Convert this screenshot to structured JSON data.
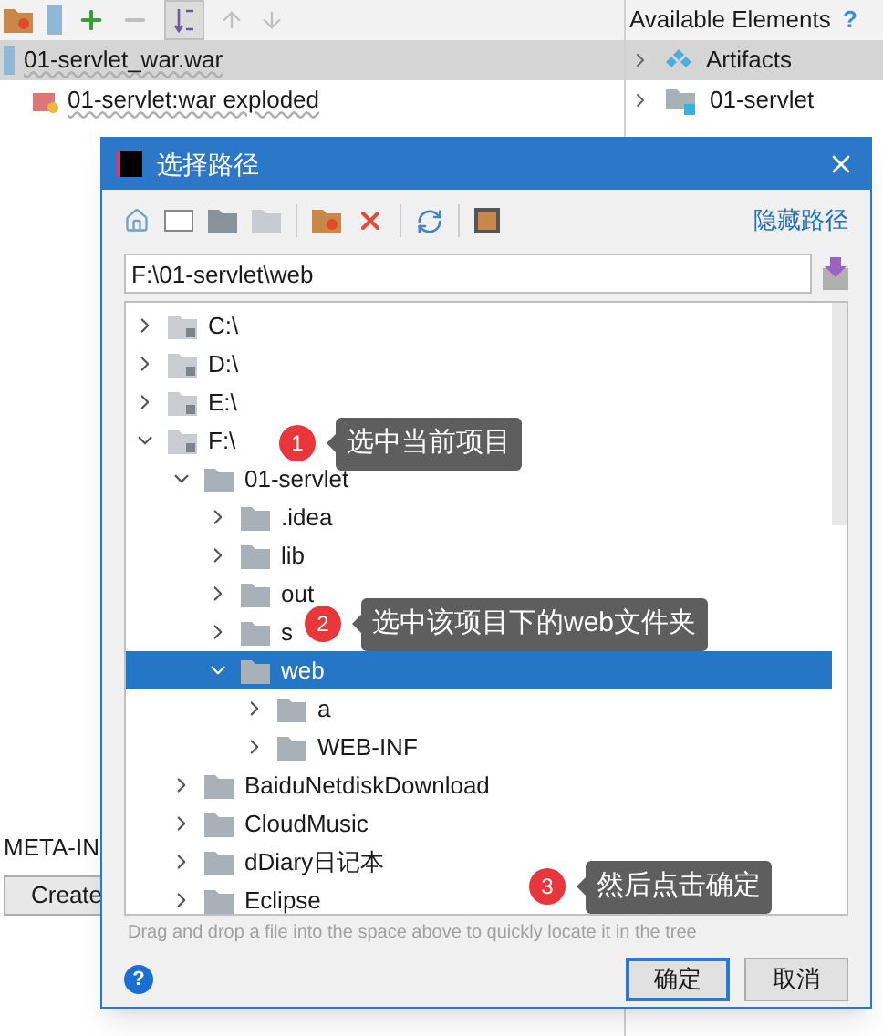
{
  "ide": {
    "available_elements": {
      "title": "Available Elements",
      "help": "?"
    },
    "artifacts": [
      {
        "label": "01-servlet_war.war",
        "selected": true,
        "kind": "archive"
      },
      {
        "label": "01-servlet:war exploded",
        "selected": false,
        "kind": "exploded"
      }
    ],
    "elements": [
      {
        "label": "Artifacts",
        "kind": "artifacts"
      },
      {
        "label": "01-servlet",
        "kind": "module"
      }
    ],
    "meta_inf": "META-IN",
    "create_button": "Create"
  },
  "dialog": {
    "title": "选择路径",
    "hide_path": "隐藏路径",
    "path": "F:\\01-servlet\\web",
    "tree": [
      {
        "label": "C:\\",
        "kind": "drive",
        "expanded": false,
        "selected": false
      },
      {
        "label": "D:\\",
        "kind": "drive",
        "expanded": false,
        "selected": false
      },
      {
        "label": "E:\\",
        "kind": "drive",
        "expanded": false,
        "selected": false
      },
      {
        "label": "F:\\",
        "kind": "drive",
        "expanded": true,
        "selected": false,
        "children": [
          {
            "label": "01-servlet",
            "kind": "folder",
            "expanded": true,
            "selected": false,
            "children": [
              {
                "label": ".idea",
                "kind": "folder",
                "expanded": false,
                "selected": false
              },
              {
                "label": "lib",
                "kind": "folder",
                "expanded": false,
                "selected": false
              },
              {
                "label": "out",
                "kind": "folder",
                "expanded": false,
                "selected": false
              },
              {
                "label": "s",
                "kind": "folder",
                "expanded": false,
                "selected": false
              },
              {
                "label": "web",
                "kind": "folder",
                "expanded": true,
                "selected": true,
                "children": [
                  {
                    "label": "a",
                    "kind": "folder",
                    "expanded": false,
                    "selected": false
                  },
                  {
                    "label": "WEB-INF",
                    "kind": "folder",
                    "expanded": false,
                    "selected": false
                  }
                ]
              }
            ]
          },
          {
            "label": "BaiduNetdiskDownload",
            "kind": "folder",
            "expanded": false,
            "selected": false
          },
          {
            "label": "CloudMusic",
            "kind": "folder",
            "expanded": false,
            "selected": false
          },
          {
            "label": "dDiary日记本",
            "kind": "folder",
            "expanded": false,
            "selected": false
          },
          {
            "label": "Eclipse",
            "kind": "folder",
            "expanded": false,
            "selected": false
          }
        ]
      }
    ],
    "hint": "Drag and drop a file into the space above to quickly locate it in the tree",
    "help": "?",
    "ok": "确定",
    "cancel": "取消"
  },
  "callouts": [
    {
      "number": "1",
      "text": "选中当前项目"
    },
    {
      "number": "2",
      "text": "选中该项目下的web文件夹"
    },
    {
      "number": "3",
      "text": "然后点击确定"
    }
  ]
}
